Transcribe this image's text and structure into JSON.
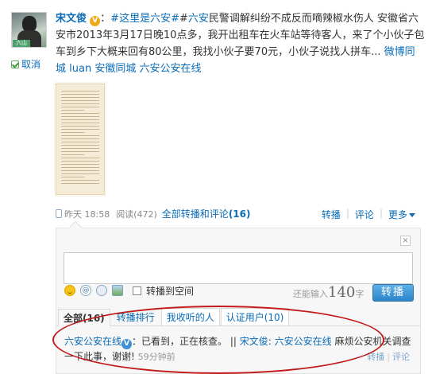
{
  "author": {
    "name": "宋文俊",
    "verified_badge": "V",
    "avatar_stamp": "六山",
    "unfollow_label": "取消"
  },
  "post": {
    "tag1": "#这里是六安#",
    "tag2": "六安",
    "text": "民警调解纠纷不成反而嘀辣椒水伤人 安徽省六安市2013年3月17日晚10点多，我开出租车在火车站等待客人，来了个小伙子包车到乡下大概来回有80公里，我找小伙子要70元，小伙子说找人拼车...",
    "link1": "微博同城",
    "link2": "luan",
    "link3": "安徽同城",
    "link4": "六安公安在线"
  },
  "meta": {
    "time": "昨天 18:58",
    "reads": "阅读(472)",
    "all_label": "全部转播和评论",
    "all_count": "(16)"
  },
  "actions": {
    "repost": "转播",
    "comment": "评论",
    "more": "更多"
  },
  "composer": {
    "close": "×",
    "also_post_label": "转播到空间",
    "remain_prefix": "还能输入",
    "remain_count": "140",
    "remain_suffix": "字",
    "submit": "转播"
  },
  "tabs": [
    {
      "label": "全部(16)"
    },
    {
      "label": "转播排行"
    },
    {
      "label": "我收听的人"
    },
    {
      "label": "认证用户(10)"
    }
  ],
  "comment": {
    "user": "六安公安在线",
    "text": "：已看到，正在核查。 ||",
    "reply_user": "宋文俊",
    "reply_sep": ":",
    "reply_mention": "六安公安在线",
    "reply_text": " 麻烦公安机关调查一下此事，谢谢!",
    "ago": "59分钟前",
    "repost": "转播",
    "comment_label": "评论"
  },
  "colors": {
    "link": "#0a6cb7",
    "annotation": "#c21a1a",
    "submit": "#2c84c8"
  }
}
